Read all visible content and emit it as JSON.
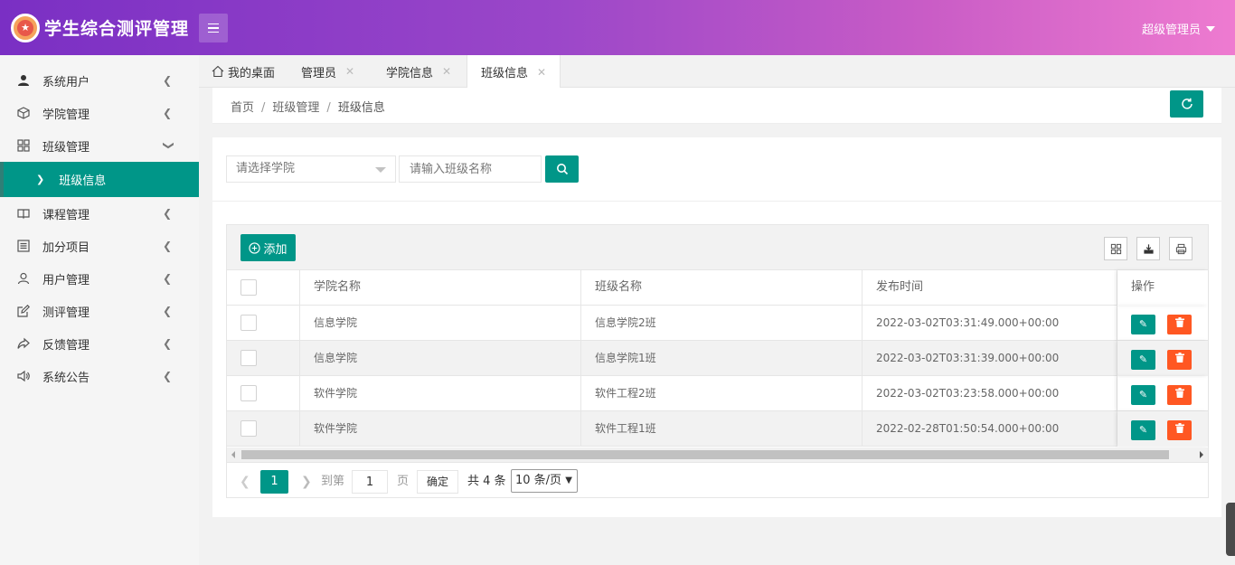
{
  "app": {
    "title": "学生综合测评管理",
    "user": "超级管理员"
  },
  "sidebar": {
    "items": [
      {
        "label": "系统用户",
        "icon": "user-icon"
      },
      {
        "label": "学院管理",
        "icon": "cube-icon"
      },
      {
        "label": "班级管理",
        "icon": "grid-icon",
        "expanded": true
      },
      {
        "label": "班级信息",
        "icon": "chevron-right-icon",
        "active": true
      },
      {
        "label": "课程管理",
        "icon": "book-icon"
      },
      {
        "label": "加分项目",
        "icon": "list-icon"
      },
      {
        "label": "用户管理",
        "icon": "person-icon"
      },
      {
        "label": "测评管理",
        "icon": "edit-icon"
      },
      {
        "label": "反馈管理",
        "icon": "share-icon"
      },
      {
        "label": "系统公告",
        "icon": "speaker-icon"
      }
    ]
  },
  "tabs": [
    {
      "label": "我的桌面",
      "icon": "home-icon",
      "closable": false
    },
    {
      "label": "管理员",
      "closable": true
    },
    {
      "label": "学院信息",
      "closable": true
    },
    {
      "label": "班级信息",
      "closable": true,
      "active": true
    }
  ],
  "breadcrumb": {
    "items": [
      "首页",
      "班级管理",
      "班级信息"
    ],
    "separator": "/"
  },
  "search": {
    "college_placeholder": "请选择学院",
    "class_placeholder": "请输入班级名称"
  },
  "toolbar": {
    "add_label": "添加"
  },
  "table": {
    "columns": [
      "学院名称",
      "班级名称",
      "发布时间",
      "操作"
    ],
    "rows": [
      {
        "college": "信息学院",
        "class": "信息学院2班",
        "time": "2022-03-02T03:31:49.000+00:00"
      },
      {
        "college": "信息学院",
        "class": "信息学院1班",
        "time": "2022-03-02T03:31:39.000+00:00"
      },
      {
        "college": "软件学院",
        "class": "软件工程2班",
        "time": "2022-03-02T03:23:58.000+00:00"
      },
      {
        "college": "软件学院",
        "class": "软件工程1班",
        "time": "2022-02-28T01:50:54.000+00:00"
      }
    ]
  },
  "pagination": {
    "current": "1",
    "goto_label": "到第",
    "goto_value": "1",
    "page_label": "页",
    "confirm_label": "确定",
    "total_label": "共 4 条",
    "page_size": "10 条/页"
  },
  "colors": {
    "primary": "#009688",
    "danger": "#ff5722",
    "header_start": "#7a2fc4",
    "header_end": "#ee7bd0"
  }
}
